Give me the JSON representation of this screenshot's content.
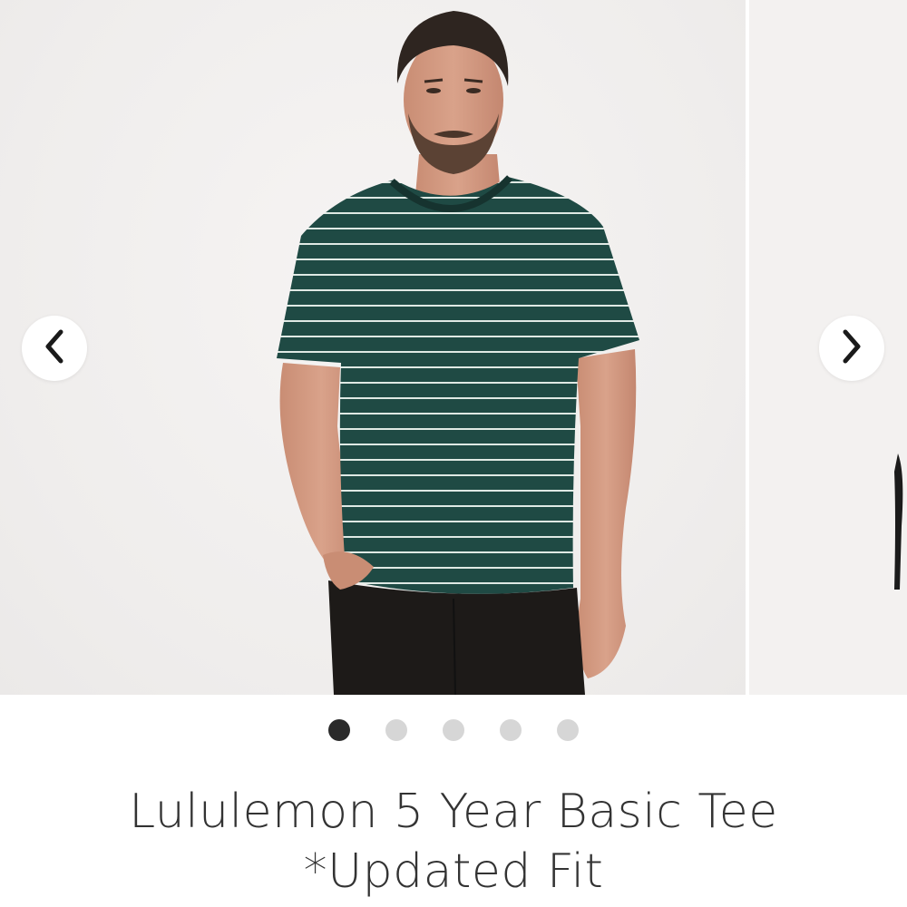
{
  "carousel": {
    "images": [
      {
        "label": "product-photo-front",
        "active": true
      },
      {
        "label": "product-photo-2",
        "active": false
      },
      {
        "label": "product-photo-3",
        "active": false
      },
      {
        "label": "product-photo-4",
        "active": false
      },
      {
        "label": "product-photo-5",
        "active": false
      }
    ],
    "prev_icon": "chevron-left-icon",
    "next_icon": "chevron-right-icon",
    "current_index": 1,
    "total": 5
  },
  "colors": {
    "shirt": "#1f4a44",
    "stripe": "#dfe9e4",
    "pants": "#1d1a18",
    "background": "#f1efee",
    "dot_active": "#2a2a2a",
    "dot_inactive": "#d6d6d6"
  },
  "product": {
    "title": "Lululemon 5 Year Basic Tee *Updated Fit"
  }
}
